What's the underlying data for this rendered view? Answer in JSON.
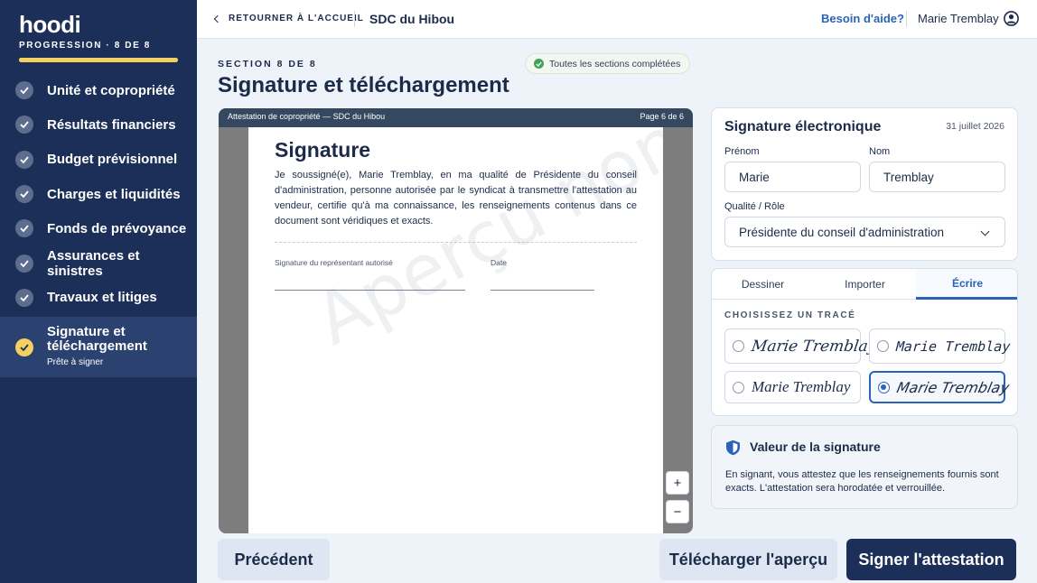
{
  "app": {
    "logo": "hoodi"
  },
  "sidebar": {
    "progress_label": "PROGRESSION · 8 DE 8",
    "progress_fraction": 1.0,
    "items": [
      {
        "label": "Unité et copropriété",
        "status": "complete"
      },
      {
        "label": "Résultats financiers",
        "status": "complete"
      },
      {
        "label": "Budget prévisionnel",
        "status": "complete"
      },
      {
        "label": "Charges et liquidités",
        "status": "complete"
      },
      {
        "label": "Fonds de prévoyance",
        "status": "complete"
      },
      {
        "label": "Assurances et sinistres",
        "status": "complete"
      },
      {
        "label": "Travaux et litiges",
        "status": "complete"
      },
      {
        "label": "Signature et téléchargement",
        "sub": "Prête à signer",
        "status": "active"
      }
    ]
  },
  "topbar": {
    "back_label": "RETOURNER À L'ACCUEIL",
    "org_name": "SDC du Hibou",
    "help_label": "Besoin d'aide?",
    "user_name": "Marie Tremblay"
  },
  "header": {
    "section_label": "SECTION 8 DE 8",
    "title": "Signature et téléchargement",
    "badge": "Toutes les sections complétées"
  },
  "preview": {
    "doc_title": "Attestation de copropriété — SDC du Hibou",
    "page_info": "Page 6 de 6",
    "heading": "Signature",
    "body": "Je soussigné(e), Marie Tremblay, en ma qualité de Présidente du conseil d'administration, personne autorisée par le syndicat à transmettre l'attestation au vendeur, certifie qu'à ma connaissance, les renseignements contenus dans ce document sont véridiques et exacts.",
    "sig_label": "Signature du représentant autorisé",
    "date_label": "Date",
    "watermark": "Aperçu non final",
    "zoom_in": "+",
    "zoom_out": "−"
  },
  "signature_card": {
    "title": "Signature électronique",
    "date": "31 juillet 2026",
    "first_name_label": "Prénom",
    "first_name_value": "Marie",
    "last_name_label": "Nom",
    "last_name_value": "Tremblay",
    "role_label": "Qualité / Rôle",
    "role_value": "Présidente du conseil d'administration"
  },
  "tabs": {
    "items": [
      "Dessiner",
      "Importer",
      "Écrire"
    ],
    "active": "Écrire",
    "choose_label": "CHOISISSEZ UN TRACÉ",
    "options": [
      {
        "text": "Marie Tremblay",
        "selected": false
      },
      {
        "text": "Marie Tremblay",
        "selected": false
      },
      {
        "text": "Marie Tremblay",
        "selected": false
      },
      {
        "text": "Marie Tremblay",
        "selected": true
      }
    ]
  },
  "value_card": {
    "title": "Valeur de la signature",
    "text": "En signant, vous attestez que les renseignements fournis sont exacts. L'attestation sera horodatée et verrouillée."
  },
  "footer": {
    "prev_label": "Précédent",
    "download_label": "Télécharger l'aperçu",
    "sign_label": "Signer l'attestation"
  },
  "colors": {
    "navy": "#1c2f58",
    "accent_yellow": "#f4d061",
    "link_blue": "#2a63b8",
    "success_green": "#3fa35a"
  }
}
